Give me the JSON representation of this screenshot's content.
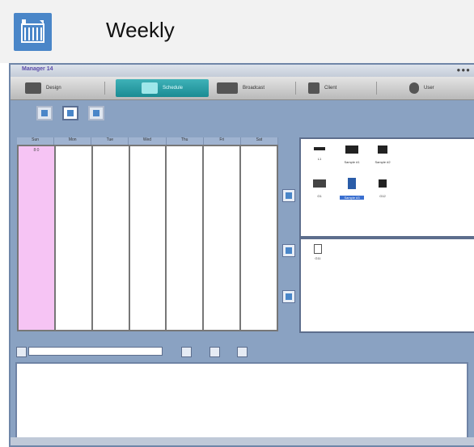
{
  "header": {
    "title": "Weekly",
    "icon": "weekly-calendar-icon",
    "accent": "#4a86c8"
  },
  "window": {
    "title": "Manager 14",
    "controls": "●●●"
  },
  "toolbar": {
    "items": [
      {
        "label": "Design",
        "icon": "design-icon"
      },
      {
        "label": "Schedule",
        "icon": "schedule-icon",
        "active": true
      },
      {
        "label": "Broadcast",
        "icon": "broadcast-icon"
      },
      {
        "label": "Client",
        "icon": "client-icon"
      },
      {
        "label": "User",
        "icon": "user-icon"
      }
    ],
    "active_color": "#1a8b93"
  },
  "views": [
    "daily-view",
    "weekly-view",
    "monthly-view"
  ],
  "calendar": {
    "days": [
      "Sun",
      "Mon",
      "Tue",
      "Wed",
      "Thu",
      "Fri",
      "Sat"
    ],
    "first_cell": "8:0",
    "highlight_color": "#f6c4f4"
  },
  "media_items": [
    {
      "label": "L1"
    },
    {
      "label": "Sample #1"
    },
    {
      "label": "Sample #2"
    },
    {
      "label": "G1"
    },
    {
      "label": "Sample #3",
      "selected": true
    },
    {
      "label": "G12"
    }
  ],
  "playlist_items": [
    {
      "label": "G11"
    }
  ],
  "bottom": {
    "input_value": ""
  }
}
